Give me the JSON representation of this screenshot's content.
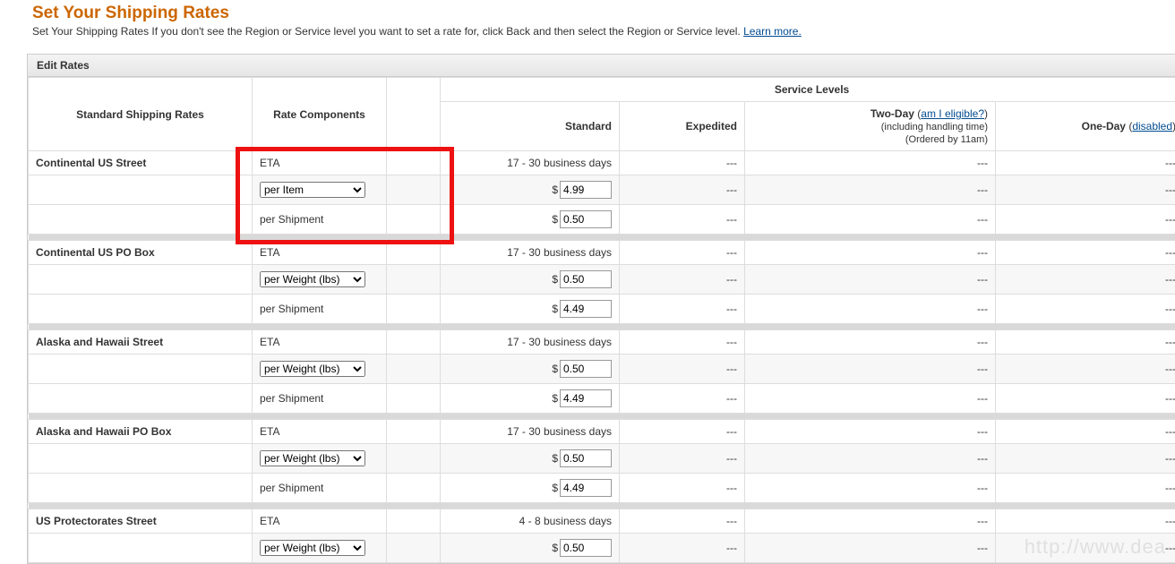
{
  "page": {
    "title": "Set Your Shipping Rates",
    "subtitle_pre": "Set Your Shipping Rates If you don't see the Region or Service level you want to set a rate for, click Back and then select the Region or Service level. ",
    "learn_more": "Learn more.",
    "panel_title": "Edit Rates"
  },
  "headers": {
    "region": "Standard Shipping Rates",
    "components": "Rate Components",
    "service_levels": "Service Levels",
    "standard": "Standard",
    "expedited": "Expedited",
    "twoday": "Two-Day",
    "twoday_eligible": "am I eligible?",
    "twoday_line2": "(including handling time)",
    "twoday_line3": "(Ordered by 11am)",
    "oneday": "One-Day",
    "oneday_status": "disabled"
  },
  "labels": {
    "eta": "ETA",
    "per_shipment": "per Shipment",
    "currency": "$",
    "dash": "---"
  },
  "select_options": {
    "per_item": "per Item",
    "per_weight": "per Weight (lbs)"
  },
  "regions": [
    {
      "name": "Continental US Street",
      "eta_standard": "17 - 30 business days",
      "rate_selector": "per_item",
      "rate_value": "4.99",
      "per_shipment_value": "0.50",
      "highlight": true
    },
    {
      "name": "Continental US PO Box",
      "eta_standard": "17 - 30 business days",
      "rate_selector": "per_weight",
      "rate_value": "0.50",
      "per_shipment_value": "4.49"
    },
    {
      "name": "Alaska and Hawaii Street",
      "eta_standard": "17 - 30 business days",
      "rate_selector": "per_weight",
      "rate_value": "0.50",
      "per_shipment_value": "4.49"
    },
    {
      "name": "Alaska and Hawaii PO Box",
      "eta_standard": "17 - 30 business days",
      "rate_selector": "per_weight",
      "rate_value": "0.50",
      "per_shipment_value": "4.49"
    },
    {
      "name": "US Protectorates Street",
      "eta_standard": "4 - 8 business days",
      "rate_selector": "per_weight",
      "rate_value": "0.50",
      "per_shipment_value": ""
    }
  ]
}
